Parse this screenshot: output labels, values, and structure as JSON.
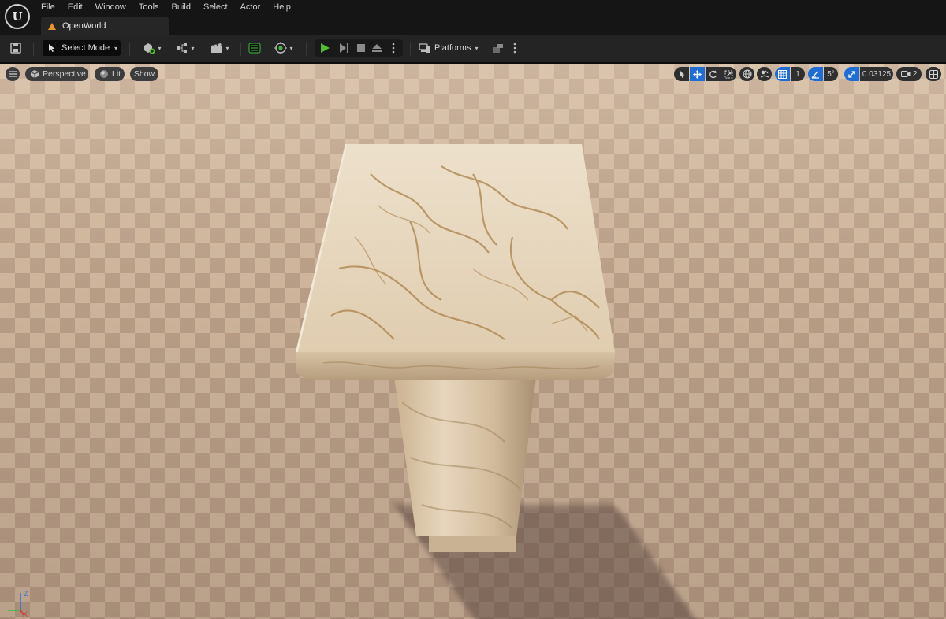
{
  "menu": {
    "items": [
      "File",
      "Edit",
      "Window",
      "Tools",
      "Build",
      "Select",
      "Actor",
      "Help"
    ]
  },
  "tab": {
    "title": "OpenWorld"
  },
  "toolbar": {
    "mode_label": "Select Mode",
    "platforms_label": "Platforms"
  },
  "viewport": {
    "view_mode": "Perspective",
    "lit_mode": "Lit",
    "show_label": "Show",
    "grid_snap_value": "1",
    "rotation_snap_value": "5°",
    "scale_snap_value": "0.03125",
    "camera_speed_value": "2"
  },
  "gizmo": {
    "z_label": "Z",
    "x_label": "X"
  },
  "colors": {
    "accent": "#1f6dd6",
    "play": "#4fbf2b",
    "axis_x": "#d23a3a",
    "axis_y": "#3fbf3f",
    "axis_z": "#3a6fe0"
  }
}
